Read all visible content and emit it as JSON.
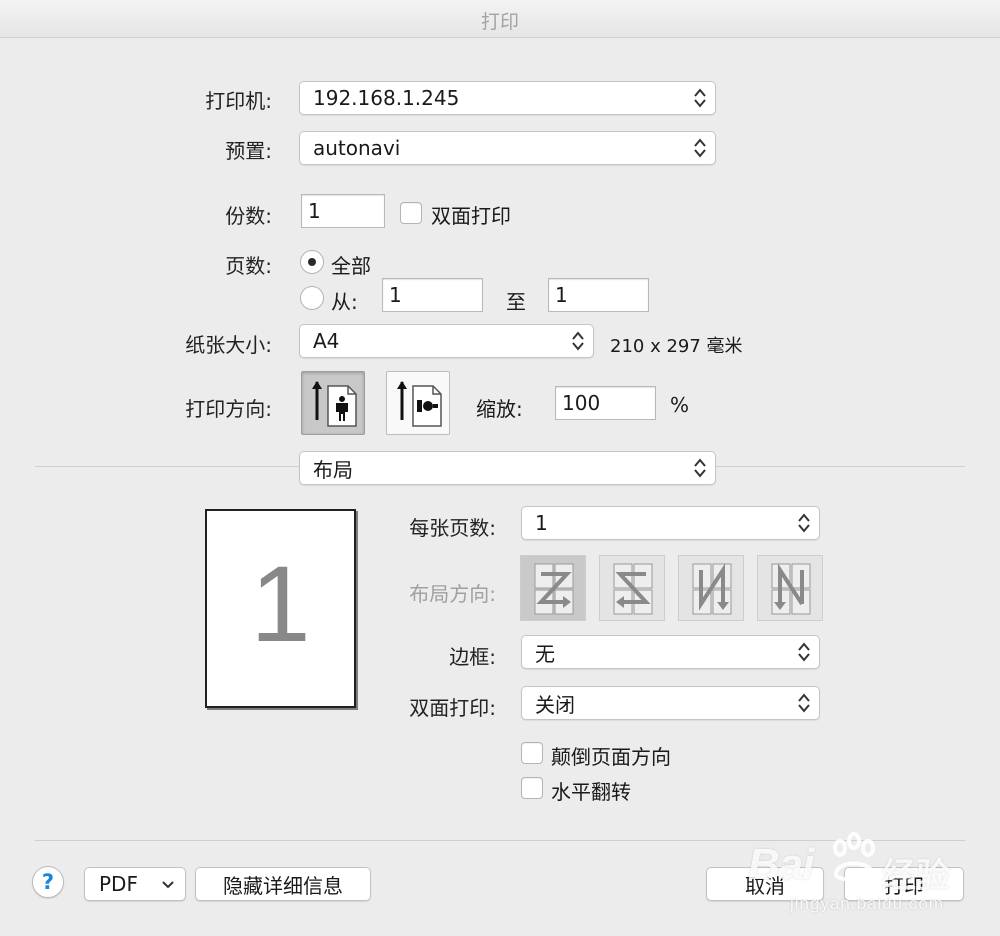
{
  "window": {
    "title": "打印"
  },
  "printer": {
    "label": "打印机:",
    "value": "192.168.1.245"
  },
  "presets": {
    "label": "预置:",
    "value": "autonavi"
  },
  "copies": {
    "label": "份数:",
    "value": "1",
    "duplex_label": "双面打印",
    "duplex_checked": false
  },
  "pages": {
    "label": "页数:",
    "all_label": "全部",
    "from_label": "从:",
    "from_value": "1",
    "to_label": "至",
    "to_value": "1",
    "selected": "all"
  },
  "paper": {
    "label": "纸张大小:",
    "value": "A4",
    "dimensions": "210 x 297 毫米"
  },
  "orientation": {
    "label": "打印方向:",
    "portrait_icon": "portrait-orientation-icon",
    "landscape_icon": "landscape-orientation-icon",
    "selected": "portrait"
  },
  "scale": {
    "label": "缩放:",
    "value": "100",
    "unit": "%"
  },
  "section": {
    "value": "布局"
  },
  "layout": {
    "preview_page_number": "1",
    "pages_per_sheet": {
      "label": "每张页数:",
      "value": "1"
    },
    "direction": {
      "label": "布局方向:",
      "options": [
        "z-icon",
        "reverse-z-icon",
        "n-icon",
        "reverse-n-icon"
      ],
      "selected": 0
    },
    "border": {
      "label": "边框:",
      "value": "无"
    },
    "two_sided": {
      "label": "双面打印:",
      "value": "关闭"
    },
    "reverse_orientation": {
      "label": "颠倒页面方向",
      "checked": false
    },
    "flip_horizontal": {
      "label": "水平翻转",
      "checked": false
    }
  },
  "footer": {
    "help": "?",
    "pdf_label": "PDF",
    "hide_details_label": "隐藏详细信息",
    "cancel_label": "取消",
    "print_label": "打印"
  },
  "watermark": {
    "brand_left": "Bai",
    "brand_right": "经验",
    "url": "jingyan.baidu.com"
  }
}
